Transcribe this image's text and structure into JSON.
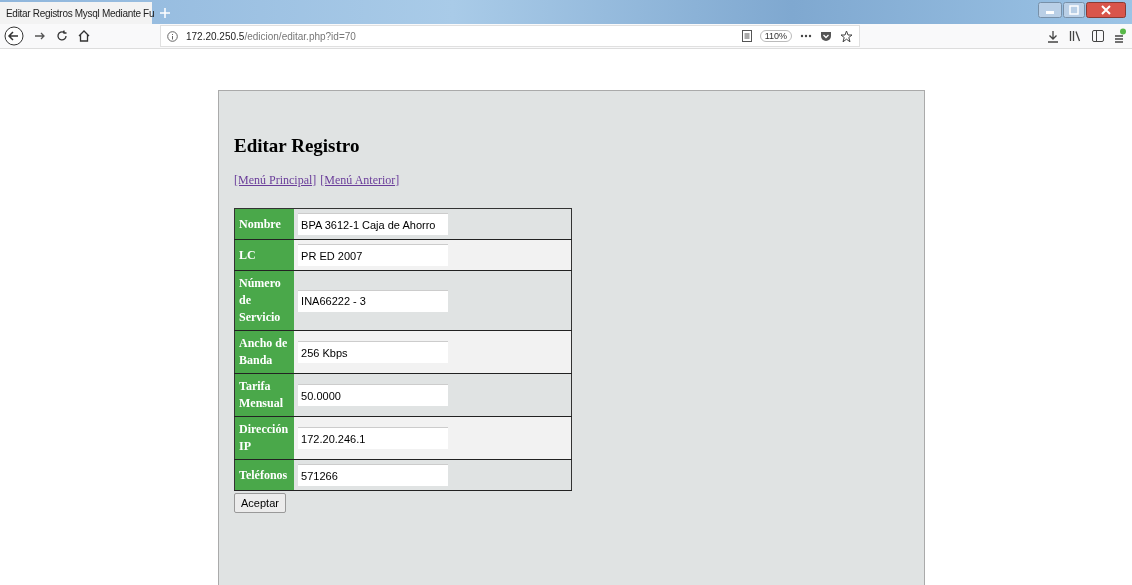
{
  "browser": {
    "tab_title": "Editar Registros Mysql Mediante Fu",
    "url_host": "172.20.250.5",
    "url_path": "/edicion/editar.php?id=70",
    "zoom": "110%"
  },
  "page": {
    "heading": "Editar Registro",
    "links": [
      "[Menú Principal]",
      "[Menú Anterior]"
    ],
    "fields": [
      {
        "label": "Nombre",
        "value": "BPA 3612-1 Caja de Ahorro"
      },
      {
        "label": "LC",
        "value": "PR ED 2007"
      },
      {
        "label": "Número de Servicio",
        "value": "INA66222 - 3"
      },
      {
        "label": "Ancho de Banda",
        "value": "256 Kbps"
      },
      {
        "label": "Tarifa Mensual",
        "value": "50.0000"
      },
      {
        "label": "Dirección IP",
        "value": "172.20.246.1"
      },
      {
        "label": "Teléfonos",
        "value": "571266"
      }
    ],
    "submit": "Aceptar"
  }
}
